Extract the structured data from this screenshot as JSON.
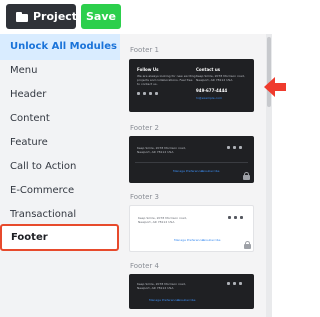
{
  "toolbar": {
    "projects_label": "Projects",
    "save_label": "Save",
    "save_color": "#2ccf4c"
  },
  "sidebar": {
    "unlock_label": "Unlock All Modules →",
    "categories": [
      "Menu",
      "Header",
      "Content",
      "Feature",
      "Call to Action",
      "E-Commerce",
      "Transactional"
    ],
    "selected": "Footer",
    "highlight_color": "#e74a2c"
  },
  "templates": {
    "items": [
      {
        "label": "Footer 1",
        "follow_title": "Follow Us",
        "follow_text": [
          "We are always looking for new exciting",
          "projects and collaborations. Feel free",
          "to contact us."
        ],
        "contact_title": "Contact us",
        "address": [
          "Keep Smile, 2078 Morrison road,",
          "Newport, AR 78112 USA"
        ],
        "phone": "949-677-4444",
        "email": "hi@example.com"
      },
      {
        "label": "Footer 2",
        "address": [
          "Keep Smile, 2078 Morrison road,",
          "Newport, AR 78112 USA"
        ],
        "links": [
          "Manage Preferences",
          "Unsubscribe"
        ]
      },
      {
        "label": "Footer 3",
        "address": [
          "Keep Smile, 2078 Morrison road,",
          "Newport, AR 78112 USA"
        ],
        "links": [
          "Manage Preferences",
          "Unsubscribe"
        ]
      },
      {
        "label": "Footer 4",
        "address": [
          "Keep Smile, 2078 Morrison road,",
          "Newport, AR 78112 USA"
        ],
        "links": [
          "Manage Preferences",
          "Unsubscribe"
        ]
      }
    ]
  }
}
